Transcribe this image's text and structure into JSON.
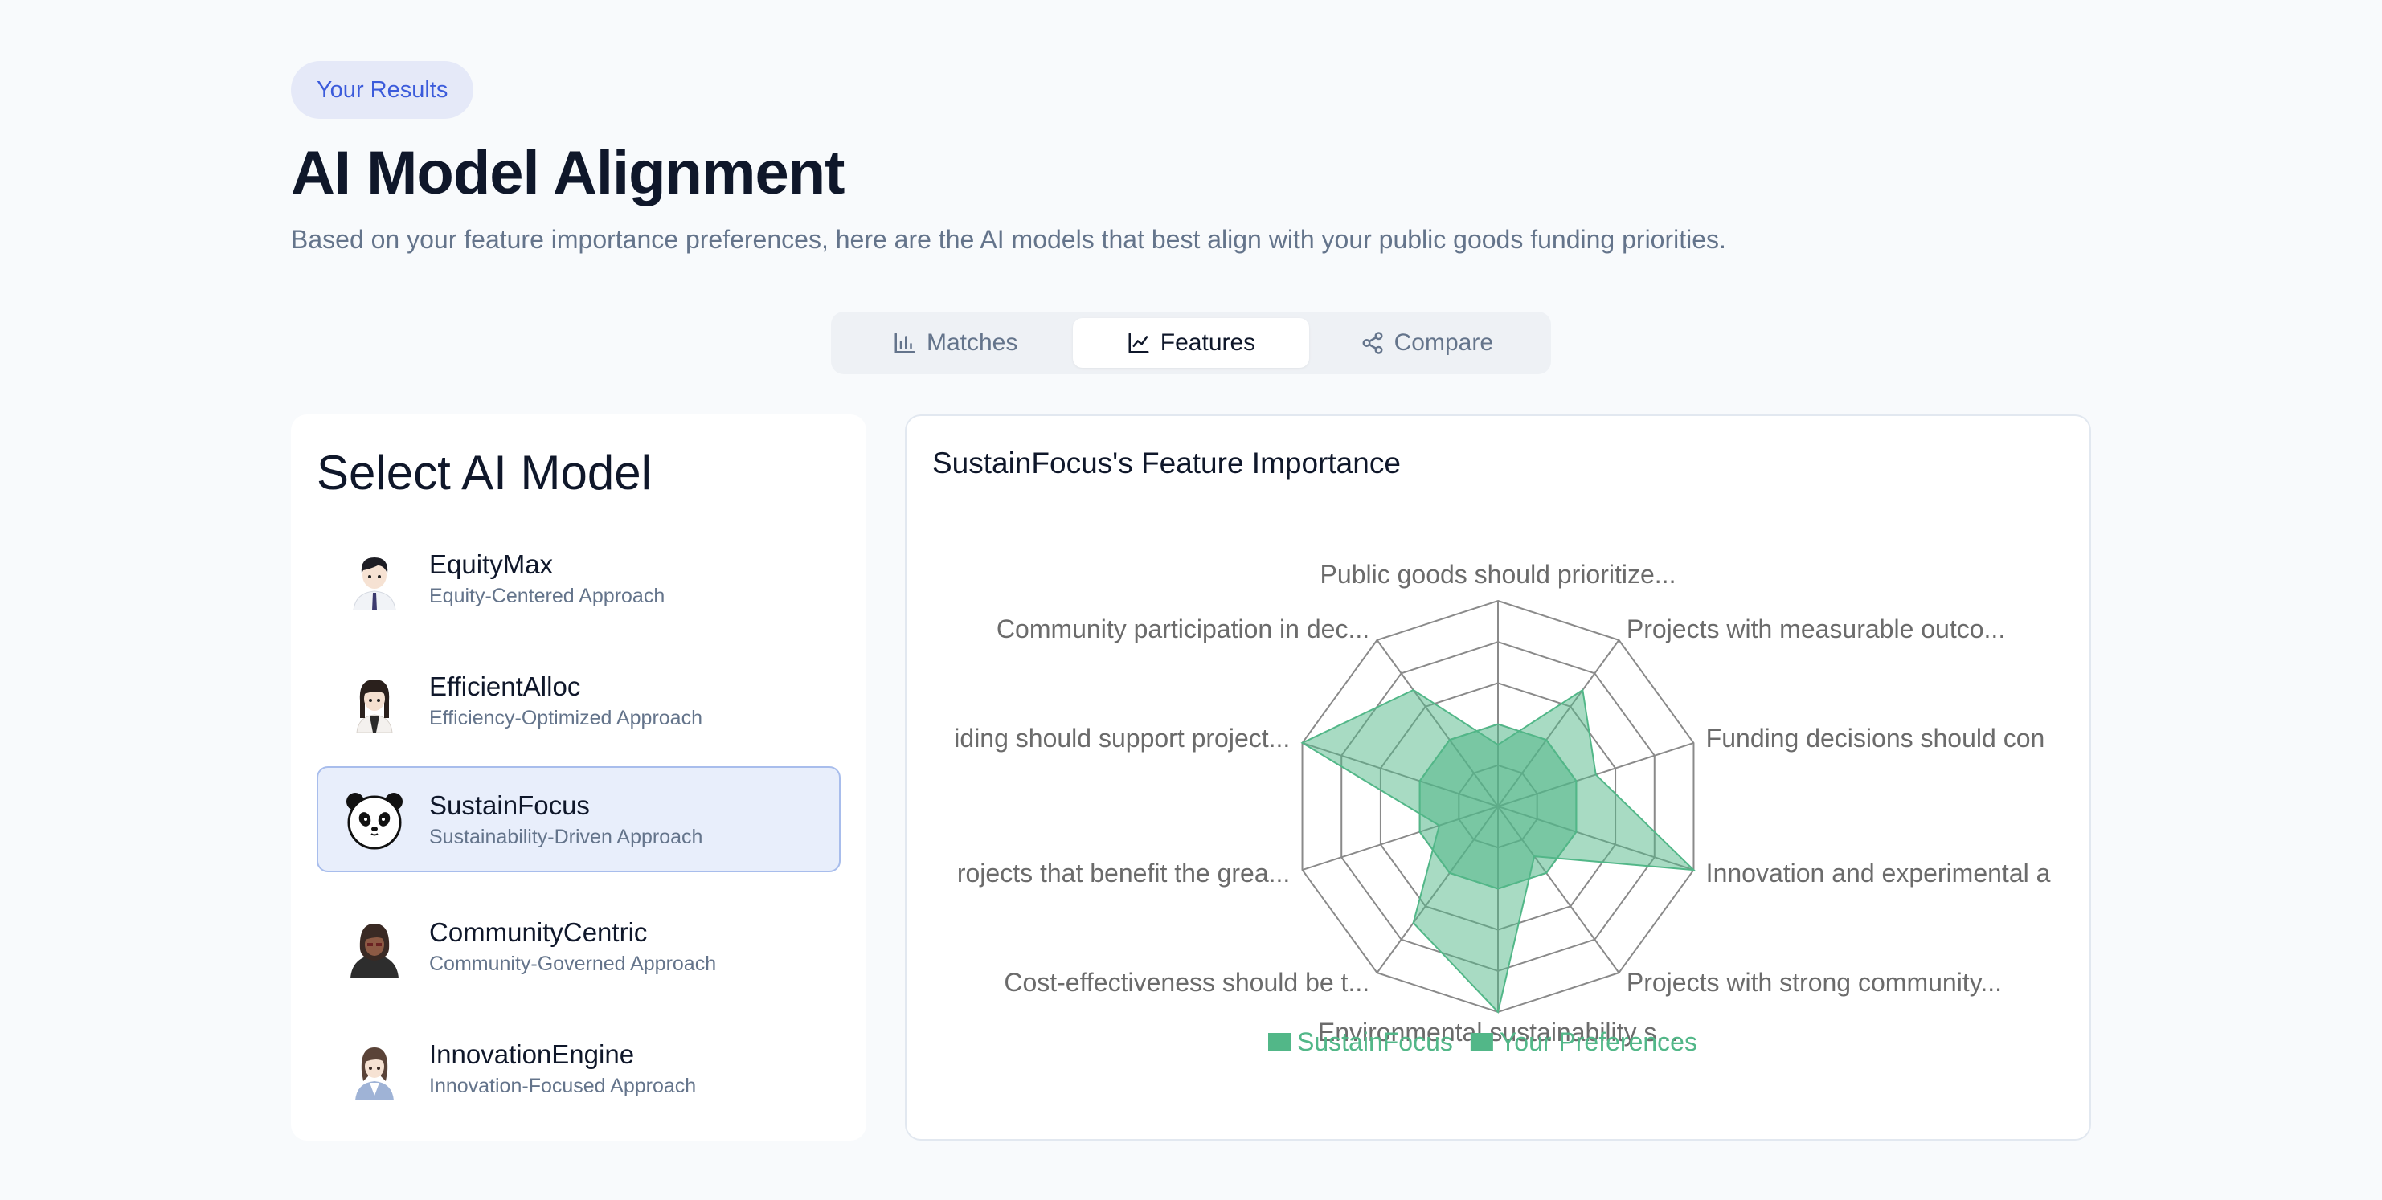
{
  "header": {
    "badge": "Your Results",
    "title": "AI Model Alignment",
    "subtitle": "Based on your feature importance preferences, here are the AI models that best align with your public goods funding priorities."
  },
  "tabs": [
    {
      "label": "Matches",
      "icon": "bar-chart-icon",
      "active": false
    },
    {
      "label": "Features",
      "icon": "line-chart-icon",
      "active": true
    },
    {
      "label": "Compare",
      "icon": "share-icon",
      "active": false
    }
  ],
  "model_panel": {
    "title": "Select AI Model",
    "models": [
      {
        "name": "EquityMax",
        "description": "Equity-Centered Approach",
        "avatar": "anime-boy-avatar",
        "selected": false
      },
      {
        "name": "EfficientAlloc",
        "description": "Efficiency-Optimized Approach",
        "avatar": "anime-girl-avatar",
        "selected": false
      },
      {
        "name": "SustainFocus",
        "description": "Sustainability-Driven Approach",
        "avatar": "panda-avatar",
        "selected": true
      },
      {
        "name": "CommunityCentric",
        "description": "Community-Governed Approach",
        "avatar": "hooded-figure-avatar",
        "selected": false
      },
      {
        "name": "InnovationEngine",
        "description": "Innovation-Focused Approach",
        "avatar": "anime-woman-avatar",
        "selected": false
      }
    ]
  },
  "chart_panel": {
    "title": "SustainFocus's Feature Importance"
  },
  "chart_data": {
    "type": "radar",
    "axes": [
      "Public goods should prioritize...",
      "Projects with measurable outco...",
      "Funding decisions should con",
      "Innovation and experimental a",
      "Projects with strong community...",
      "Environmental sustainability s...",
      "Cost-effectiveness should be t...",
      "rojects that benefit the grea...",
      "iding should support project...",
      "Community participation in dec..."
    ],
    "rlim": [
      0,
      5
    ],
    "rings": 5,
    "series": [
      {
        "name": "SustainFocus",
        "values": [
          1.5,
          3.5,
          2.5,
          5,
          1.5,
          5,
          3.5,
          1.5,
          5,
          3.5
        ],
        "color": "#52b788"
      },
      {
        "name": "Your Preferences",
        "values": [
          2,
          2,
          2,
          2,
          2,
          2,
          2,
          2,
          2,
          2
        ],
        "color": "#52b788"
      }
    ],
    "legend": "bottom",
    "legend_color": "#52b788"
  },
  "colors": {
    "accent": "#3b5bdb",
    "selected_bg": "#e8eefb",
    "series_fill": "#52b788"
  }
}
